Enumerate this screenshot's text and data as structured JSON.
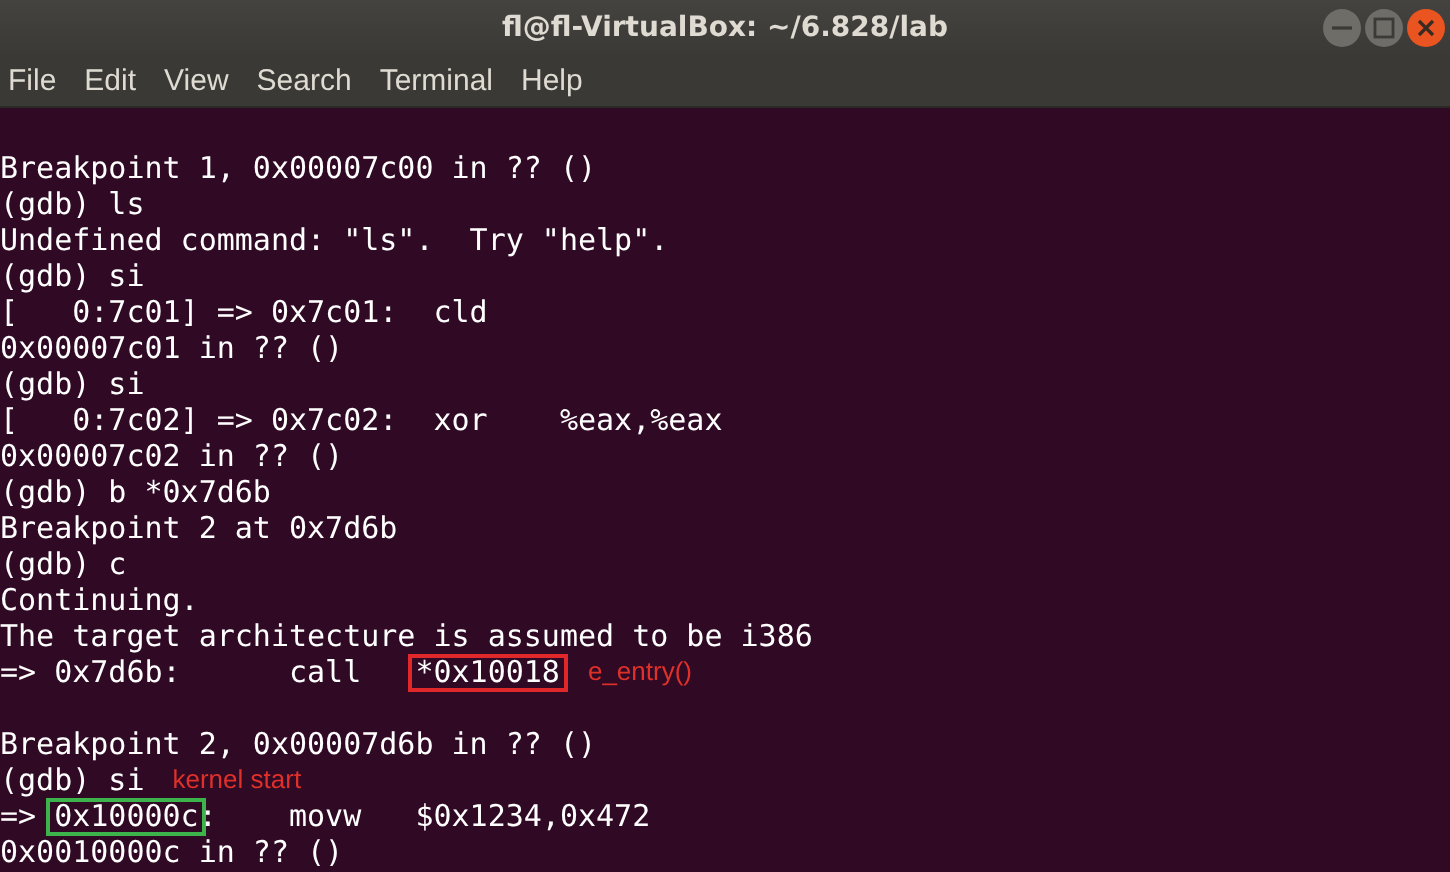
{
  "window": {
    "title": "fl@fl-VirtualBox: ~/6.828/lab"
  },
  "menu": [
    "File",
    "Edit",
    "View",
    "Search",
    "Terminal",
    "Help"
  ],
  "terminal": {
    "lines": [
      {
        "gap_before": true,
        "segments": [
          {
            "kind": "plain",
            "text": "Breakpoint 1, 0x00007c00 in ?? ()"
          }
        ]
      },
      {
        "segments": [
          {
            "kind": "plain",
            "text": "(gdb) ls"
          }
        ]
      },
      {
        "segments": [
          {
            "kind": "plain",
            "text": "Undefined command: \"ls\".  Try \"help\"."
          }
        ]
      },
      {
        "segments": [
          {
            "kind": "plain",
            "text": "(gdb) si"
          }
        ]
      },
      {
        "segments": [
          {
            "kind": "plain",
            "text": "[   0:7c01] => 0x7c01:  cld"
          }
        ]
      },
      {
        "segments": [
          {
            "kind": "plain",
            "text": "0x00007c01 in ?? ()"
          }
        ]
      },
      {
        "segments": [
          {
            "kind": "plain",
            "text": "(gdb) si"
          }
        ]
      },
      {
        "segments": [
          {
            "kind": "plain",
            "text": "[   0:7c02] => 0x7c02:  xor    %eax,%eax"
          }
        ]
      },
      {
        "segments": [
          {
            "kind": "plain",
            "text": "0x00007c02 in ?? ()"
          }
        ]
      },
      {
        "segments": [
          {
            "kind": "plain",
            "text": "(gdb) b *0x7d6b"
          }
        ]
      },
      {
        "segments": [
          {
            "kind": "plain",
            "text": "Breakpoint 2 at 0x7d6b"
          }
        ]
      },
      {
        "segments": [
          {
            "kind": "plain",
            "text": "(gdb) c"
          }
        ]
      },
      {
        "segments": [
          {
            "kind": "plain",
            "text": "Continuing."
          }
        ]
      },
      {
        "segments": [
          {
            "kind": "plain",
            "text": "The target architecture is assumed to be i386"
          }
        ]
      },
      {
        "segments": [
          {
            "kind": "plain",
            "text": "=> 0x7d6b:      call   "
          },
          {
            "kind": "red-box",
            "text": "*0x10018"
          }
        ],
        "note": "e_entry()"
      },
      {
        "gap_before": true,
        "segments": [
          {
            "kind": "plain",
            "text": "Breakpoint 2, 0x00007d6b in ?? ()"
          }
        ]
      },
      {
        "segments": [
          {
            "kind": "plain",
            "text": "(gdb) si"
          }
        ],
        "note": "kernel start"
      },
      {
        "segments": [
          {
            "kind": "plain",
            "text": "=> "
          },
          {
            "kind": "green-box",
            "text": "0x10000c"
          },
          {
            "kind": "plain",
            "text": ":    movw   $0x1234,0x472"
          }
        ]
      },
      {
        "segments": [
          {
            "kind": "plain",
            "text": "0x0010000c in ?? ()"
          }
        ]
      }
    ]
  }
}
